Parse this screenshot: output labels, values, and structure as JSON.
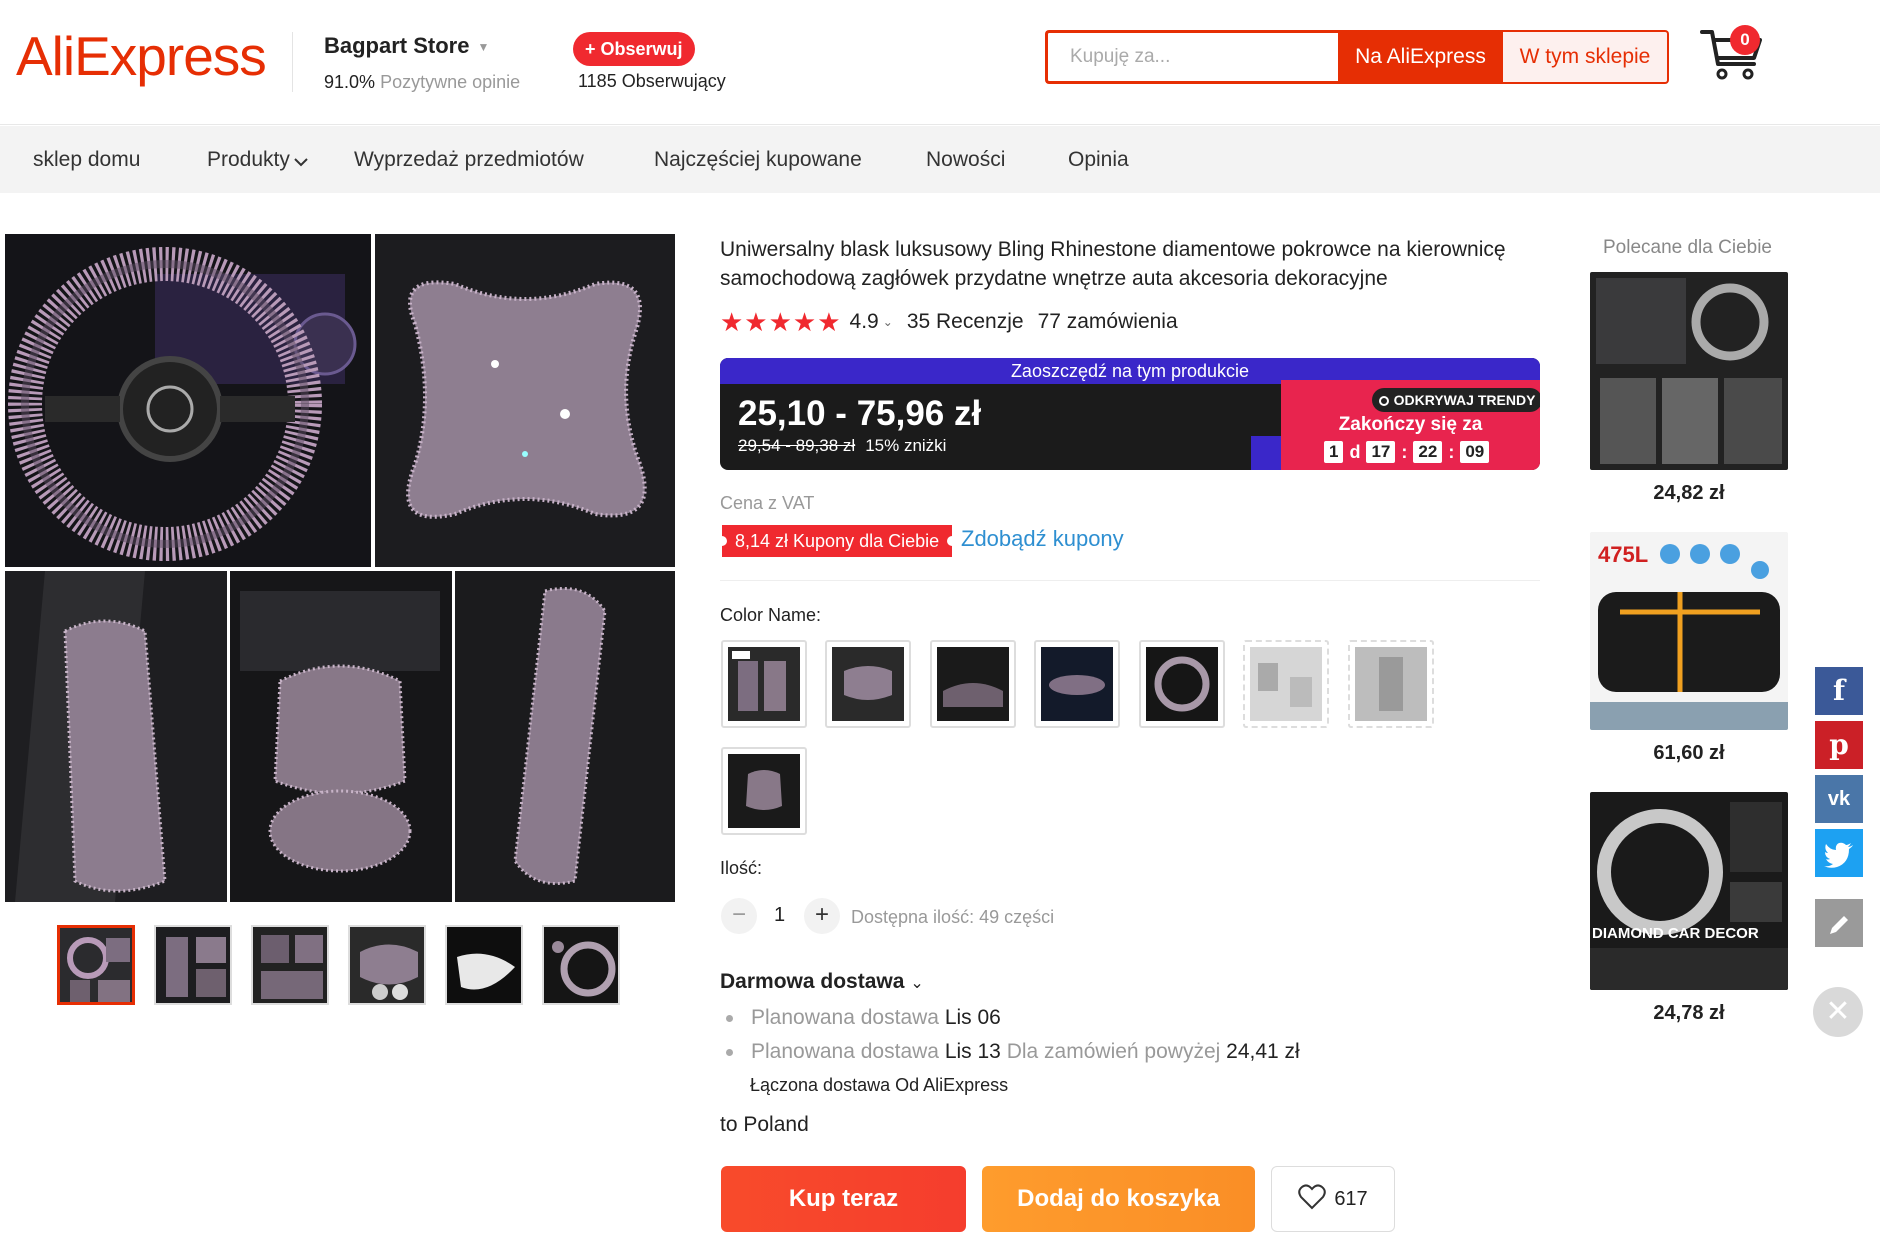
{
  "header": {
    "logo": "AliExpress",
    "store_name": "Bagpart Store",
    "positive_pct": "91.0%",
    "positive_label": "Pozytywne opinie",
    "follow_label": "+ Obserwuj",
    "followers_count": "1185",
    "followers_label": "Obserwujący",
    "search_placeholder": "Kupuję za...",
    "search_ali_label": "Na AliExpress",
    "search_shop_label": "W tym sklepie",
    "cart_count": "0"
  },
  "nav": {
    "items": [
      "sklep domu",
      "Produkty",
      "Wyprzedaż przedmiotów",
      "Najczęściej kupowane",
      "Nowości",
      "Opinia"
    ]
  },
  "product": {
    "title": "Uniwersalny blask luksusowy Bling Rhinestone diamentowe pokrowce na kierownicę samochodową zagłówek przydatne wnętrze auta akcesoria dekoracyjne",
    "stars": "★★★★★",
    "rating": "4.9",
    "reviews": "35 Recenzje",
    "orders": "77 zamówienia",
    "deal": {
      "banner": "Zaoszczędź na tym produkcie",
      "price": "25,10 - 75,96 zł",
      "old_price": "29,54 - 89,38 zł",
      "discount": "15% zniżki",
      "badge": "ODKRYWAJ TRENDY",
      "ends_label": "Zakończy się za",
      "days": "1",
      "days_unit": "d",
      "hours": "17",
      "minutes": "22",
      "seconds": "09"
    },
    "vat_label": "Cena z VAT",
    "coupon_tag": "8,14 zł Kupony dla Ciebie",
    "coupon_link": "Zdobądź kupony",
    "color_label": "Color Name:",
    "quantity_label": "Ilość:",
    "quantity_minus": "−",
    "quantity_value": "1",
    "quantity_plus": "+",
    "quantity_available": "Dostępna ilość: 49 części",
    "shipping": {
      "title": "Darmowa dostawa",
      "line1_prefix": "Planowana dostawa",
      "line1_date": "Lis 06",
      "line2_prefix": "Planowana dostawa",
      "line2_date": "Lis 13",
      "line2_mid": "Dla zamówień powyżej",
      "line2_amount": "24,41 zł",
      "combined": "Łączona dostawa  Od AliExpress",
      "to_label": "to",
      "country": "Poland"
    },
    "buy_now": "Kup teraz",
    "add_to_cart": "Dodaj do koszyka",
    "wishlist_count": "617"
  },
  "recommended": {
    "title": "Polecane dla Ciebie",
    "items": [
      {
        "price": "24,82 zł"
      },
      {
        "price": "61,60 zł",
        "tag": "475L"
      },
      {
        "price": "24,78 zł",
        "tag": "DIAMOND CAR DECOR"
      }
    ]
  },
  "social": [
    "facebook-icon",
    "pinterest-icon",
    "vk-icon",
    "twitter-icon",
    "edit-icon",
    "close-icon"
  ]
}
